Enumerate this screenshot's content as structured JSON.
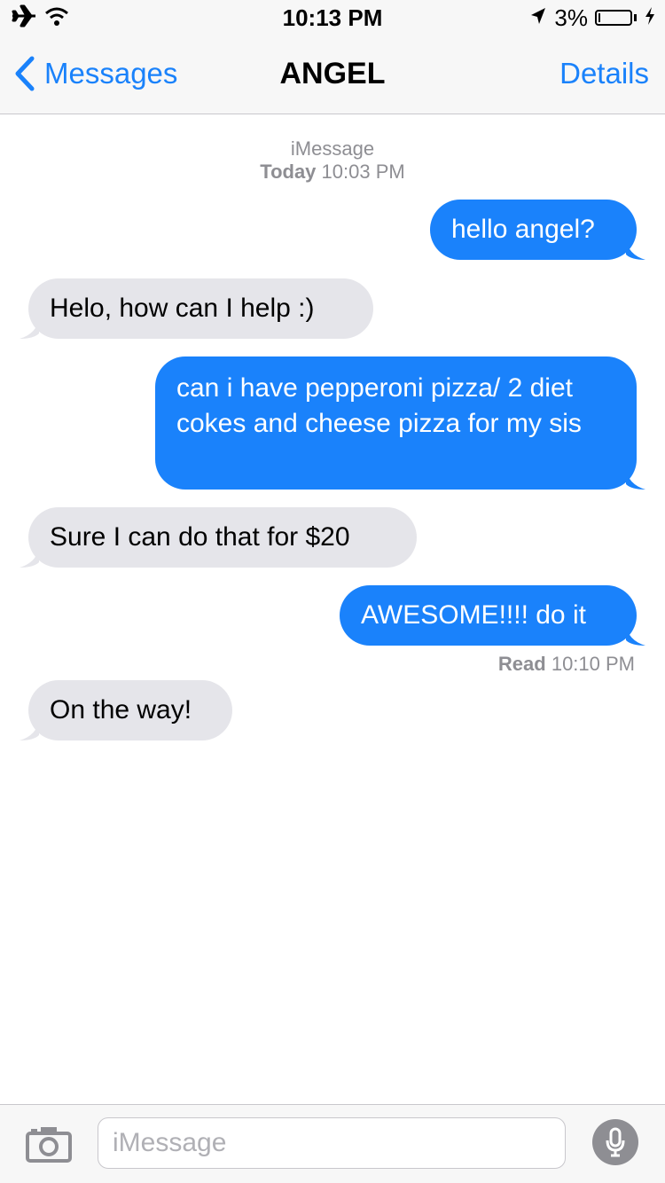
{
  "status_bar": {
    "time": "10:13 PM",
    "battery_percent": "3%",
    "icons": [
      "airplane-icon",
      "wifi-icon",
      "location-arrow-icon",
      "battery-icon",
      "charging-bolt-icon"
    ]
  },
  "nav": {
    "back_label": "Messages",
    "title": "ANGEL",
    "details_label": "Details"
  },
  "thread": {
    "service": "iMessage",
    "date_label": "Today",
    "date_time": "10:03 PM",
    "messages": [
      {
        "from": "me",
        "text": "hello angel?"
      },
      {
        "from": "them",
        "text": "Helo, how can I help :)"
      },
      {
        "from": "me",
        "text": "can i have pepperoni pizza/ 2 diet cokes and cheese pizza for my sis"
      },
      {
        "from": "them",
        "text": "Sure I can do that for $20"
      },
      {
        "from": "me",
        "text": "AWESOME!!!! do it"
      },
      {
        "from": "them",
        "text": "On the way!"
      }
    ],
    "read_label": "Read",
    "read_time": "10:10 PM"
  },
  "input_bar": {
    "placeholder": "iMessage",
    "icons": [
      "camera-icon",
      "microphone-icon"
    ]
  },
  "colors": {
    "accent": "#1a82fb",
    "incoming_bubble": "#e5e5ea",
    "meta_text": "#8e8e93",
    "bar_background": "#f7f7f7"
  }
}
